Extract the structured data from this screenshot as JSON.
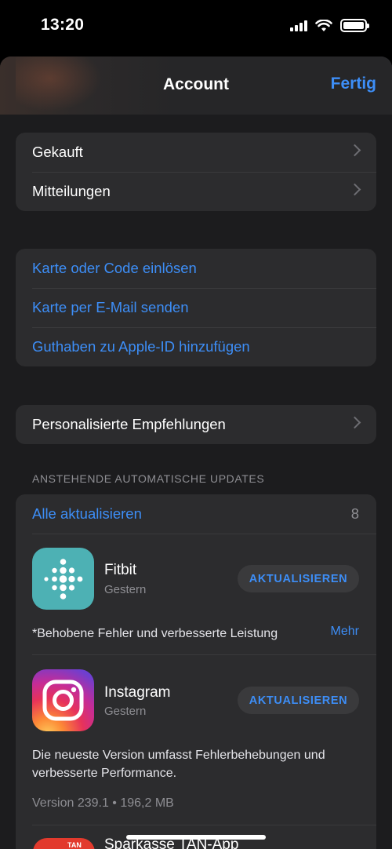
{
  "status_bar": {
    "time": "13:20",
    "icons": [
      "cellular-signal-icon",
      "wifi-icon",
      "battery-icon"
    ]
  },
  "nav": {
    "title": "Account",
    "done_label": "Fertig"
  },
  "group1": {
    "items": [
      {
        "label": "Gekauft"
      },
      {
        "label": "Mitteilungen"
      }
    ]
  },
  "group2": {
    "items": [
      {
        "label": "Karte oder Code einlösen"
      },
      {
        "label": "Karte per E-Mail senden"
      },
      {
        "label": "Guthaben zu Apple-ID hinzufügen"
      }
    ]
  },
  "group3": {
    "items": [
      {
        "label": "Personalisierte Empfehlungen"
      }
    ]
  },
  "updates": {
    "section_header": "ANSTEHENDE AUTOMATISCHE UPDATES",
    "update_all_label": "Alle aktualisieren",
    "count": "8",
    "apps": [
      {
        "name": "Fitbit",
        "date": "Gestern",
        "button_label": "AKTUALISIEREN",
        "note": "*Behobene Fehler und verbesserte Leistung",
        "more_label": "Mehr"
      },
      {
        "name": "Instagram",
        "date": "Gestern",
        "button_label": "AKTUALISIEREN",
        "note_line1": "Die neueste Version umfasst Fehlerbehebungen und",
        "note_line2": "verbesserte Performance.",
        "version_info": "Version 239.1 • 196,2 MB"
      },
      {
        "name": "Sparkasse TAN-App",
        "icon_label": "TAN"
      }
    ]
  },
  "colors": {
    "accent": "#3d8ef7",
    "background": "#1c1c1e",
    "card": "#2c2c2e",
    "secondary_text": "#8e8e93"
  }
}
